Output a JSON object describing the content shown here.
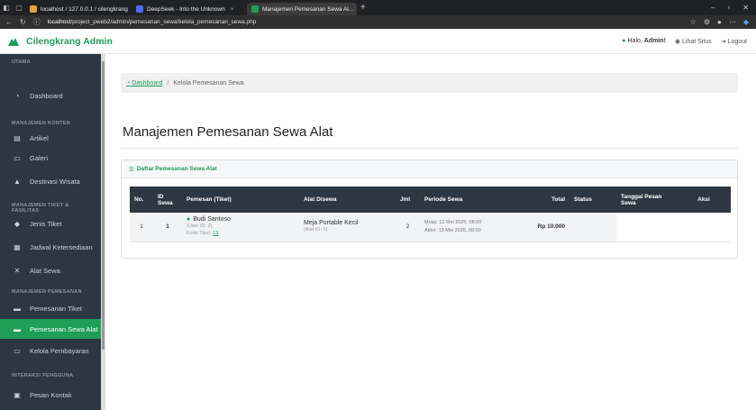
{
  "browser": {
    "tabs": [
      {
        "label": "localhost / 127.0.0.1 / cilengkrang",
        "color": "#e8a33d"
      },
      {
        "label": "DeepSeek - Into the Unknown",
        "color": "#4a6cf7"
      },
      {
        "label": "Manajemen Pemesanan Sewa Al...",
        "color": "#1e9e57"
      }
    ],
    "new_tab_label": "+",
    "url_host": "localhost",
    "url_path": "/project_pweb2/admin/pemesanan_sewa/kelola_pemesanan_sewa.php"
  },
  "header": {
    "brand": "Cilengkrang Admin",
    "hello_prefix": "Halo, ",
    "hello_name": "Admin!",
    "view_site": "Lihat Situs",
    "logout": "Logout"
  },
  "sidebar": {
    "sections": [
      {
        "title": "UTAMA"
      },
      {
        "title": "MANAJEMEN KONTEN"
      },
      {
        "title": "MANAJEMEN TIKET & FASILITAS"
      },
      {
        "title": "MANAJEMEN PEMESANAN"
      },
      {
        "title": "INTERAKSI PENGGUNA"
      }
    ],
    "items": [
      {
        "label": "Dashboard",
        "icon": "dashboard-icon"
      },
      {
        "label": "Artikel",
        "icon": "newspaper-icon"
      },
      {
        "label": "Galeri",
        "icon": "image-icon"
      },
      {
        "label": "Destinasi Wisata",
        "icon": "mountain-icon"
      },
      {
        "label": "Jenis Tiket",
        "icon": "tag-icon"
      },
      {
        "label": "Jadwal Ketersediaan",
        "icon": "calendar-icon"
      },
      {
        "label": "Alat Sewa",
        "icon": "tools-icon"
      },
      {
        "label": "Pemesanan Tiket",
        "icon": "ticket-icon"
      },
      {
        "label": "Pemesanan Sewa Alat",
        "icon": "ticket-icon"
      },
      {
        "label": "Kelola Pembayaran",
        "icon": "payment-icon"
      },
      {
        "label": "Pesan Kontak",
        "icon": "message-icon"
      }
    ],
    "active_index": 8
  },
  "breadcrumb": {
    "home": "Dashboard",
    "sep": "/",
    "current": "Kelola Pemesanan Sewa"
  },
  "page_title": "Manajemen Pemesanan Sewa Alat",
  "card": {
    "title": "Daftar Pemesanan Sewa Alat"
  },
  "table": {
    "headers": [
      "No.",
      "ID Sewa",
      "Pemesan (Tiket)",
      "Alat Disewa",
      "Jml",
      "Periode Sewa",
      "Total",
      "Status",
      "Tanggal Pesan Sewa",
      "Aksi"
    ],
    "rows": [
      {
        "no": "1",
        "id": "1",
        "name": "Budi Santoso",
        "user_id": "(User ID: 2)",
        "ticket_label": "Kode Tiket: ",
        "ticket_code": "13",
        "tool": "Meja Portable Kecil",
        "tool_id": "(Alat ID: 1)",
        "qty": "2",
        "start": "Mulai: 12 Mei 2025, 08:00",
        "end": "Akhir: 13 Mei 2025, 08:00",
        "total": "Rp 10.000",
        "status": "",
        "date": "",
        "action": ""
      }
    ]
  }
}
